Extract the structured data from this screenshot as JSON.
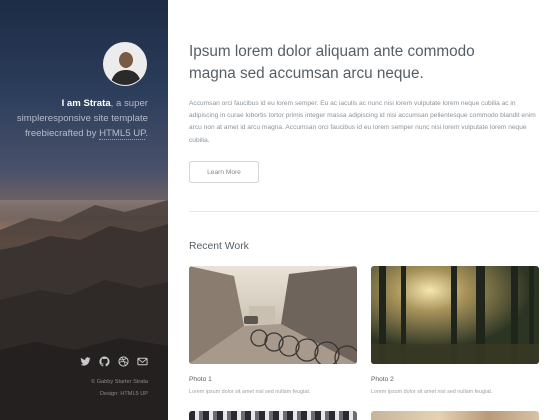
{
  "sidebar": {
    "intro_name": "I am Strata",
    "intro_line1_rest": ", a super",
    "intro_line2": "simpleresponsive site template",
    "intro_line3_prefix": "freebiecrafted by ",
    "intro_link": "HTML5 UP",
    "intro_line3_suffix": ".",
    "social_icons": [
      "twitter-icon",
      "github-icon",
      "dribbble-icon",
      "envelope-icon"
    ],
    "credit_line1": "© Gabby Starter Strata",
    "credit_line2": "Design: HTML5 UP"
  },
  "main": {
    "headline_line1": "Ipsum lorem dolor aliquam ante commodo",
    "headline_line2": "magna sed accumsan arcu neque.",
    "lead": "Accumsan orci faucibus id eu lorem semper. Eu ac iaculis ac nunc nisi lorem vulputate lorem neque cubilia ac in adipiscing in curae lobortis tortor primis integer massa adipiscing id nisi accumsan pellentesque commodo blandit enim arcu non at amet id arcu magna. Accumsan orci faucibus id eu lorem semper nunc nisi lorem vulputate lorem neque cubilia.",
    "button_label": "Learn More",
    "section_title": "Recent Work",
    "works": [
      {
        "caption": "Photo 1",
        "desc": "Lorem ipsum dolor sit amet nisl sed nullam feugiat."
      },
      {
        "caption": "Photo 2",
        "desc": "Lorem ipsum dolor sit amet nisl sed nullam feugiat."
      }
    ]
  },
  "colors": {
    "heading": "#555e66",
    "body_text": "#7f888f",
    "divider": "#e6e7e8"
  }
}
